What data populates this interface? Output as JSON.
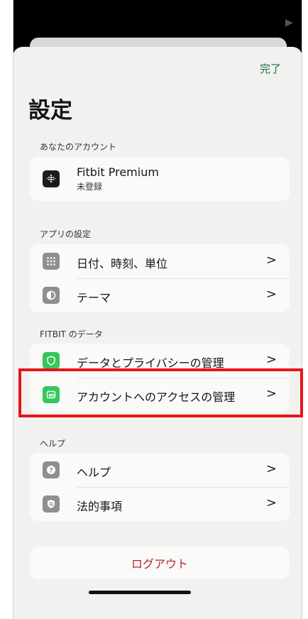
{
  "header": {
    "done_label": "完了",
    "title": "設定",
    "status_glyph": "▶"
  },
  "account_section": {
    "header": "あなたのアカウント",
    "item": {
      "title": "Fitbit Premium",
      "subtitle": "未登録",
      "icon": "fitbit-logo-icon"
    }
  },
  "app_settings_section": {
    "header": "アプリの設定",
    "items": [
      {
        "label": "日付、時刻、単位",
        "icon": "grid-icon",
        "icon_color": "#8e8e93"
      },
      {
        "label": "テーマ",
        "icon": "half-circle-icon",
        "icon_color": "#8e8e93"
      }
    ]
  },
  "fitbit_data_section": {
    "header": "FITBIT のデータ",
    "items": [
      {
        "label": "データとプライバシーの管理",
        "icon": "shield-icon",
        "icon_color": "#34c759"
      },
      {
        "label": "アカウントへのアクセスの管理",
        "icon": "access-icon",
        "icon_color": "#34c759"
      }
    ]
  },
  "help_section": {
    "header": "ヘルプ",
    "items": [
      {
        "label": "ヘルプ",
        "icon": "question-icon",
        "icon_color": "#8e8e93"
      },
      {
        "label": "法的事項",
        "icon": "legal-icon",
        "icon_color": "#8e8e93"
      }
    ]
  },
  "logout": {
    "label": "ログアウト",
    "color": "#b3272d"
  },
  "chevron": ">",
  "highlight_color": "#e8141b"
}
